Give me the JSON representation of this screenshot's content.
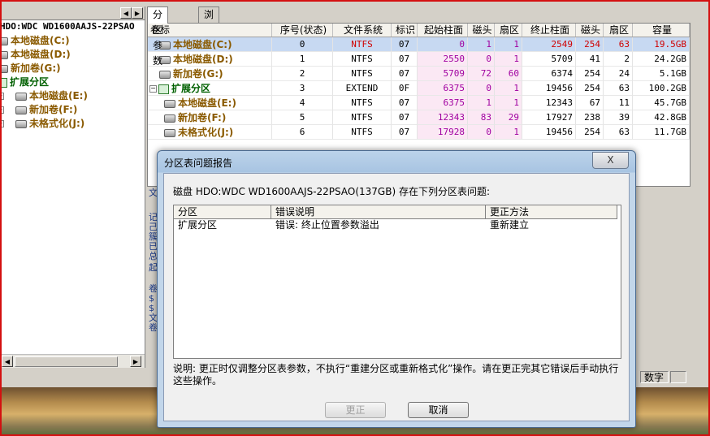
{
  "left_panel": {
    "disk_header": "HDO:WDC WD1600AAJS-22PSAO",
    "tree": [
      {
        "label": "本地磁盘(C:)",
        "type": "drive",
        "indent": 0
      },
      {
        "label": "本地磁盘(D:)",
        "type": "drive",
        "indent": 0
      },
      {
        "label": "新加卷(G:)",
        "type": "drive",
        "indent": 0
      },
      {
        "label": "扩展分区",
        "type": "extended",
        "indent": 0
      },
      {
        "label": "本地磁盘(E:)",
        "type": "drive",
        "indent": 1
      },
      {
        "label": "新加卷(F:)",
        "type": "drive",
        "indent": 1
      },
      {
        "label": "未格式化(J:)",
        "type": "drive",
        "indent": 1
      }
    ]
  },
  "tabs": [
    "分区参数",
    "浏览文件"
  ],
  "grid": {
    "columns": [
      "卷标",
      "序号(状态)",
      "文件系统",
      "标识",
      "起始柱面",
      "磁头",
      "扇区",
      "终止柱面",
      "磁头",
      "扇区",
      "容量"
    ],
    "rows": [
      {
        "label": "本地磁盘(C:)",
        "index": "0",
        "fs": "NTFS",
        "id": "07",
        "start_cyl": "0",
        "start_head": "1",
        "start_sec": "1",
        "end_cyl": "2549",
        "end_head": "254",
        "end_sec": "63",
        "size": "19.5GB"
      },
      {
        "label": "本地磁盘(D:)",
        "index": "1",
        "fs": "NTFS",
        "id": "07",
        "start_cyl": "2550",
        "start_head": "0",
        "start_sec": "1",
        "end_cyl": "5709",
        "end_head": "41",
        "end_sec": "2",
        "size": "24.2GB"
      },
      {
        "label": "新加卷(G:)",
        "index": "2",
        "fs": "NTFS",
        "id": "07",
        "start_cyl": "5709",
        "start_head": "72",
        "start_sec": "60",
        "end_cyl": "6374",
        "end_head": "254",
        "end_sec": "24",
        "size": "5.1GB"
      },
      {
        "label": "扩展分区",
        "index": "3",
        "fs": "EXTEND",
        "id": "0F",
        "start_cyl": "6375",
        "start_head": "0",
        "start_sec": "1",
        "end_cyl": "19456",
        "end_head": "254",
        "end_sec": "63",
        "size": "100.2GB"
      },
      {
        "label": "本地磁盘(E:)",
        "index": "4",
        "fs": "NTFS",
        "id": "07",
        "start_cyl": "6375",
        "start_head": "1",
        "start_sec": "1",
        "end_cyl": "12343",
        "end_head": "67",
        "end_sec": "11",
        "size": "45.7GB"
      },
      {
        "label": "新加卷(F:)",
        "index": "5",
        "fs": "NTFS",
        "id": "07",
        "start_cyl": "12343",
        "start_head": "83",
        "start_sec": "29",
        "end_cyl": "17927",
        "end_head": "238",
        "end_sec": "39",
        "size": "42.8GB"
      },
      {
        "label": "未格式化(J:)",
        "index": "6",
        "fs": "NTFS",
        "id": "07",
        "start_cyl": "17928",
        "start_head": "0",
        "start_sec": "1",
        "end_cyl": "19456",
        "end_head": "254",
        "end_sec": "63",
        "size": "11.7GB"
      }
    ]
  },
  "side_text": [
    "文",
    "记",
    "己",
    "簇",
    "已",
    "总",
    "起",
    "卷",
    "$",
    "$",
    "文",
    "卷"
  ],
  "statusbar": {
    "num_label": "数字"
  },
  "dialog": {
    "title": "分区表问题报告",
    "close_label": "X",
    "message": "磁盘 HDO:WDC WD1600AAJS-22PSAO(137GB) 存在下列分区表问题:",
    "list_columns": [
      "分区",
      "错误说明",
      "更正方法"
    ],
    "list_rows": [
      {
        "partition": "扩展分区",
        "error": "错误: 终止位置参数溢出",
        "fix": "重新建立"
      }
    ],
    "note": "说明: 更正时仅调整分区表参数，不执行“重建分区或重新格式化”操作。请在更正完其它错误后手动执行这些操作。",
    "fix_button": "更正",
    "cancel_button": "取消"
  },
  "colors": {
    "selected_row": "#c7d9f2",
    "drive_label": "#8a5a00",
    "ntfs_highlight": "#d00000",
    "dialog_frame": "#a8c4e2"
  }
}
